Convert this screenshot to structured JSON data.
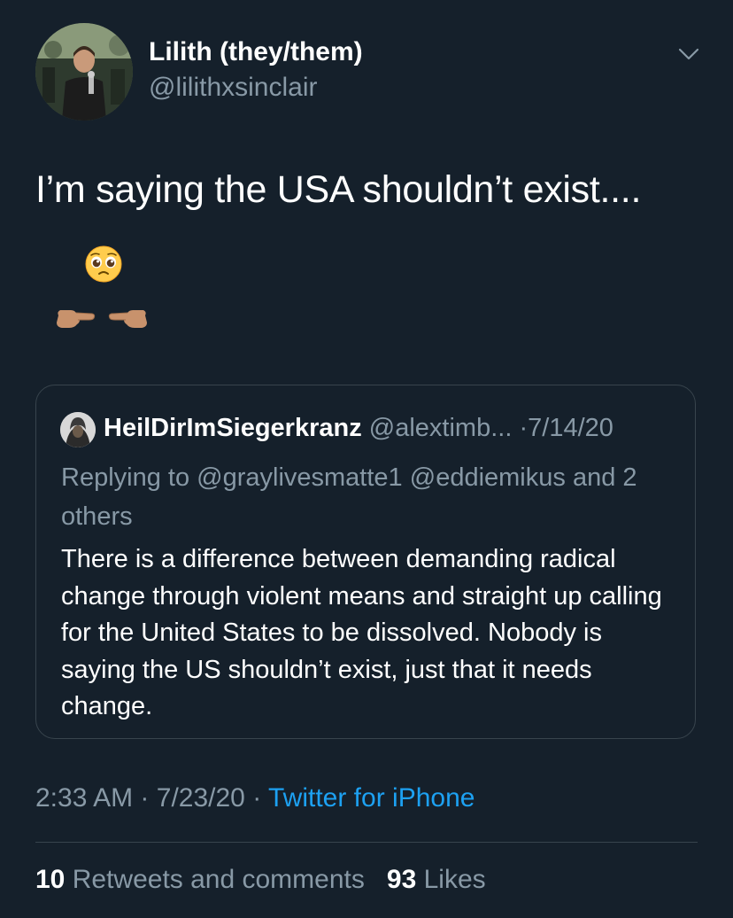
{
  "author": {
    "display_name": "Lilith (they/them)",
    "handle": "@lilithxsinclair",
    "avatar_icon": "profile-photo"
  },
  "menu_icon": "chevron-down-icon",
  "tweet": {
    "text": "I’m saying the USA shouldn’t exist....",
    "emojis": [
      "pleading-face",
      "index-fingers-pointing"
    ]
  },
  "quoted": {
    "display_name": "HeilDirImSiegerkranz",
    "handle": "@alextimb...",
    "separator": "·",
    "date": "7/14/20",
    "replying_label": "Replying to",
    "mentions": [
      "@graylivesmatte1",
      "@eddiemikus"
    ],
    "replying_tail": "and 2 others",
    "text": "There is a difference between demanding radical change through violent means and straight up calling for the United States to be dissolved. Nobody is saying the US shouldn’t exist, just that it needs change."
  },
  "meta": {
    "time": "2:33 AM",
    "sep1": "·",
    "date": "7/23/20",
    "sep2": "·",
    "source": "Twitter for iPhone"
  },
  "stats": {
    "retweets_count": "10",
    "retweets_label": "Retweets and comments",
    "likes_count": "93",
    "likes_label": "Likes"
  },
  "colors": {
    "background": "#15202b",
    "secondary_text": "#8899a6",
    "link": "#1da1f2",
    "border": "#38444d"
  }
}
